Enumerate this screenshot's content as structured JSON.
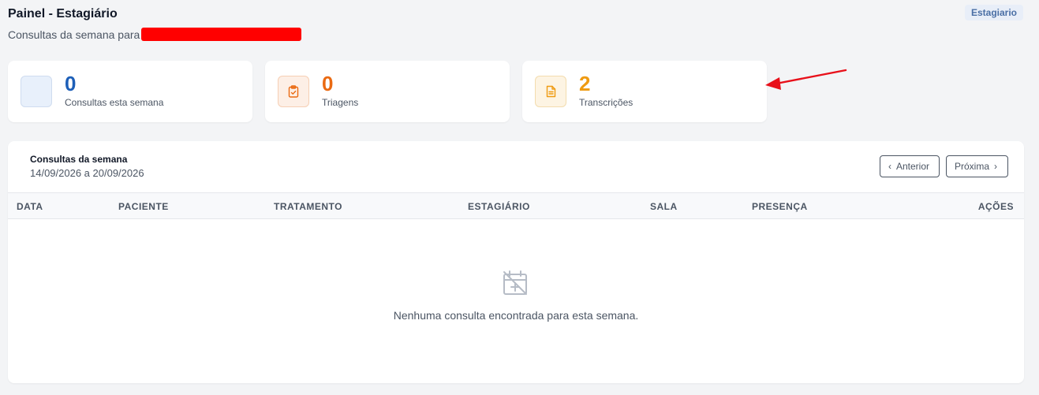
{
  "header": {
    "title": "Painel - Estagiário",
    "subtitle": "Consultas da semana para",
    "role_badge": "Estagiario"
  },
  "stats": [
    {
      "value": "0",
      "label": "Consultas esta semana",
      "icon": "calendar-icon",
      "color": "#1d5fb8"
    },
    {
      "value": "0",
      "label": "Triagens",
      "icon": "clipboard-check-icon",
      "color": "#ea6a12"
    },
    {
      "value": "2",
      "label": "Transcrições",
      "icon": "document-icon",
      "color": "#ef9b12"
    }
  ],
  "annotation": {
    "color": "#e8101a",
    "icon": "red-arrow-icon"
  },
  "week_panel": {
    "title": "Consultas da semana",
    "date_range": "14/09/2026 a 20/09/2026",
    "prev_label": "Anterior",
    "next_label": "Próxima",
    "columns": [
      "DATA",
      "PACIENTE",
      "TRATAMENTO",
      "ESTAGIÁRIO",
      "SALA",
      "PRESENÇA",
      "AÇÕES"
    ],
    "rows": [],
    "empty_message": "Nenhuma consulta encontrada para esta semana.",
    "empty_icon": "calendar-off-icon"
  }
}
